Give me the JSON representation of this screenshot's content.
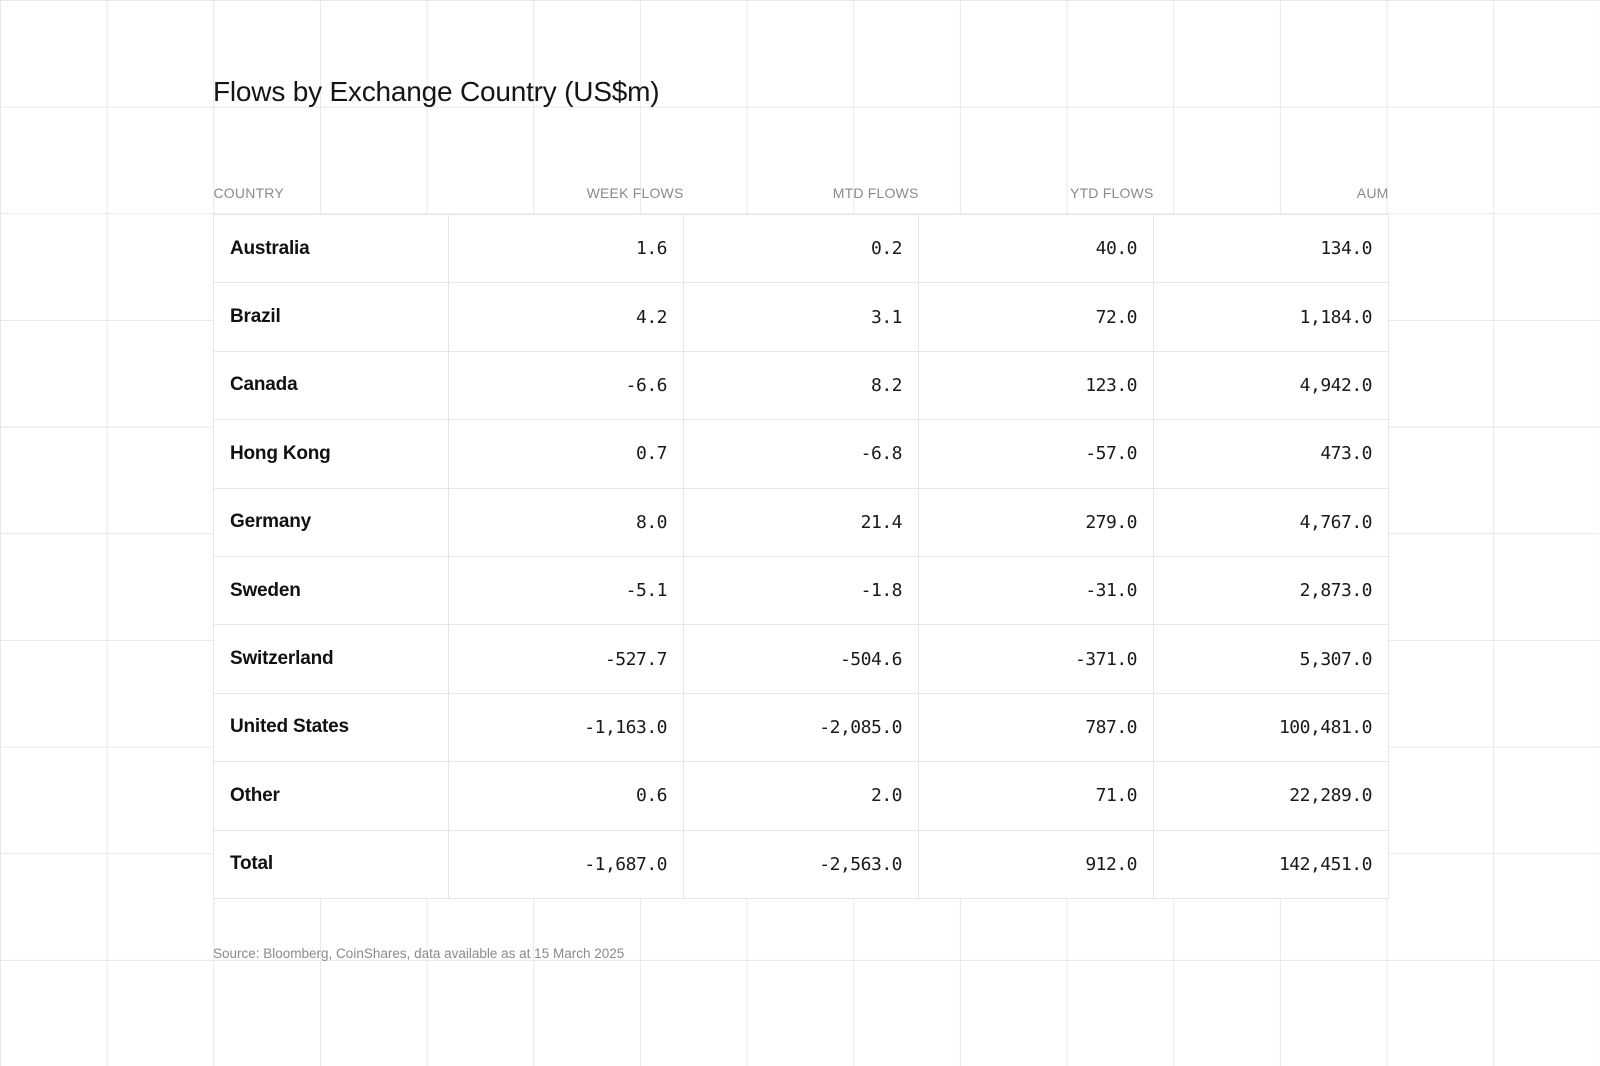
{
  "title": "Flows by Exchange Country (US$m)",
  "source": "Source: Bloomberg, CoinShares, data available as at 15 March 2025",
  "chart_data": {
    "type": "table",
    "title": "Flows by Exchange Country (US$m)",
    "columns": [
      "COUNTRY",
      "WEEK FLOWS",
      "MTD FLOWS",
      "YTD FLOWS",
      "AUM"
    ],
    "rows": [
      [
        "Australia",
        "1.6",
        "0.2",
        "40.0",
        "134.0"
      ],
      [
        "Brazil",
        "4.2",
        "3.1",
        "72.0",
        "1,184.0"
      ],
      [
        "Canada",
        "-6.6",
        "8.2",
        "123.0",
        "4,942.0"
      ],
      [
        "Hong Kong",
        "0.7",
        "-6.8",
        "-57.0",
        "473.0"
      ],
      [
        "Germany",
        "8.0",
        "21.4",
        "279.0",
        "4,767.0"
      ],
      [
        "Sweden",
        "-5.1",
        "-1.8",
        "-31.0",
        "2,873.0"
      ],
      [
        "Switzerland",
        "-527.7",
        "-504.6",
        "-371.0",
        "5,307.0"
      ],
      [
        "United States",
        "-1,163.0",
        "-2,085.0",
        "787.0",
        "100,481.0"
      ],
      [
        "Other",
        "0.6",
        "2.0",
        "71.0",
        "22,289.0"
      ],
      [
        "Total",
        "-1,687.0",
        "-2,563.0",
        "912.0",
        "142,451.0"
      ]
    ],
    "source": "Source: Bloomberg, CoinShares, data available as at 15 March 2025"
  }
}
